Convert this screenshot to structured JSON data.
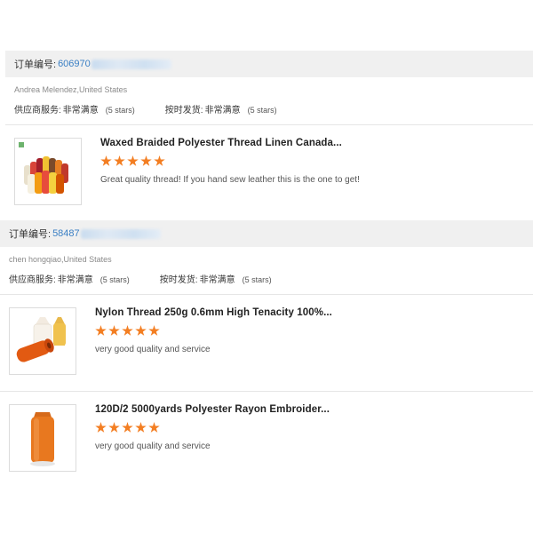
{
  "orders": [
    {
      "order_label": "订单编号:",
      "order_number_visible": "606970",
      "buyer": "Andrea Melendez,United States",
      "ratings": [
        {
          "label": "供应商服务:",
          "value": "非常满意",
          "stars_text": "(5 stars)"
        },
        {
          "label": "按时发货:",
          "value": "非常满意",
          "stars_text": "(5 stars)"
        }
      ],
      "products": [
        {
          "title": "Waxed Braided Polyester Thread Linen Canada...",
          "rating": 5,
          "review": "Great quality thread! If you hand sew leather this is the one to get!"
        }
      ]
    },
    {
      "order_label": "订单编号:",
      "order_number_visible": "58487",
      "buyer": "chen hongqiao,United States",
      "ratings": [
        {
          "label": "供应商服务:",
          "value": "非常满意",
          "stars_text": "(5 stars)"
        },
        {
          "label": "按时发货:",
          "value": "非常满意",
          "stars_text": "(5 stars)"
        }
      ],
      "products": [
        {
          "title": "Nylon Thread 250g 0.6mm High Tenacity 100%...",
          "rating": 5,
          "review": "very good quality and service"
        },
        {
          "title": "120D/2 5000yards Polyester Rayon Embroider...",
          "rating": 5,
          "review": "very good quality and service"
        }
      ]
    }
  ],
  "colors": {
    "star": "#f37e22",
    "order_number": "#3a7fc4",
    "header_bg": "#f0f0f0"
  }
}
